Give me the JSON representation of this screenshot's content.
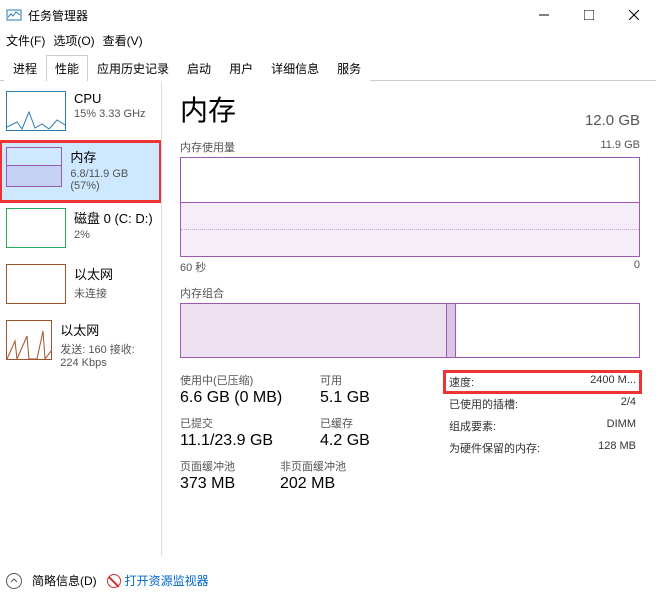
{
  "window": {
    "title": "任务管理器"
  },
  "menu": {
    "file": "文件(F)",
    "options": "选项(O)",
    "view": "查看(V)"
  },
  "tabs": [
    "进程",
    "性能",
    "应用历史记录",
    "启动",
    "用户",
    "详细信息",
    "服务"
  ],
  "active_tab": 1,
  "sidebar": [
    {
      "name": "CPU",
      "stat": "15% 3.33 GHz",
      "kind": "cpu"
    },
    {
      "name": "内存",
      "stat": "6.8/11.9 GB (57%)",
      "kind": "mem",
      "selected": true,
      "red": true
    },
    {
      "name": "磁盘 0 (C: D:)",
      "stat": "2%",
      "kind": "disk"
    },
    {
      "name": "以太网",
      "stat": "未连接",
      "kind": "eth"
    },
    {
      "name": "以太网",
      "stat": "发送: 160 接收: 224 Kbps",
      "kind": "eth"
    }
  ],
  "main": {
    "title": "内存",
    "total": "12.0 GB",
    "usage_label": "内存使用量",
    "usage_max": "11.9 GB",
    "x_left": "60 秒",
    "x_right": "0",
    "comp_label": "内存组合",
    "stats": [
      [
        {
          "lbl": "使用中(已压缩)",
          "val": "6.6 GB (0 MB)"
        },
        {
          "lbl": "可用",
          "val": "5.1 GB"
        }
      ],
      [
        {
          "lbl": "已提交",
          "val": "11.1/23.9 GB"
        },
        {
          "lbl": "已缓存",
          "val": "4.2 GB"
        }
      ],
      [
        {
          "lbl": "页面缓冲池",
          "val": "373 MB"
        },
        {
          "lbl": "非页面缓冲池",
          "val": "202 MB"
        }
      ]
    ],
    "details": [
      {
        "lbl": "速度:",
        "val": "2400 M...",
        "red": true
      },
      {
        "lbl": "已使用的插槽:",
        "val": "2/4"
      },
      {
        "lbl": "组成要素:",
        "val": "DIMM"
      },
      {
        "lbl": "为硬件保留的内存:",
        "val": "128 MB"
      }
    ]
  },
  "footer": {
    "brief": "简略信息(D)",
    "monitor": "打开资源监视器"
  },
  "chart_data": {
    "type": "area",
    "title": "内存使用量",
    "ylabel": "GB",
    "ylim": [
      0,
      11.9
    ],
    "x": [
      "60 秒",
      "0"
    ],
    "series": [
      {
        "name": "used",
        "values": [
          6.8,
          6.8
        ]
      }
    ]
  }
}
